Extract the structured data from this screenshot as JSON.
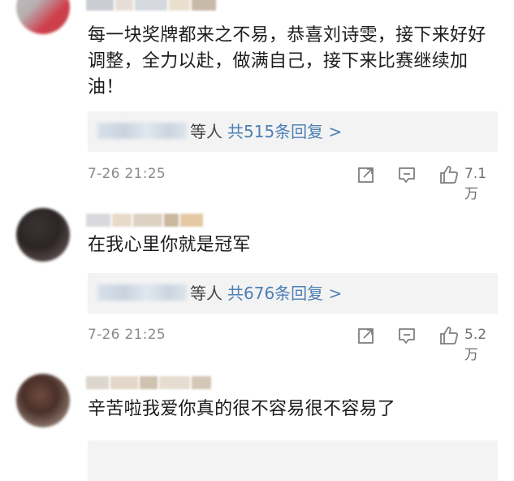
{
  "comments": [
    {
      "text": "每一块奖牌都来之不易，恭喜刘诗雯，接下来好好调整，全力以赴，做满自己，接下来比赛继续加油！",
      "reply_prefix": "等人",
      "reply_link": "共515条回复 >",
      "time": "7-26 21:25",
      "likes": "7.1万"
    },
    {
      "text": "在我心里你就是冠军",
      "reply_prefix": "等人",
      "reply_link": "共676条回复 >",
      "time": "7-26 21:25",
      "likes": "5.2万"
    },
    {
      "text": "辛苦啦我爱你真的很不容易很不容易了"
    }
  ],
  "icons": [
    "share-icon",
    "reply-icon",
    "like-icon"
  ],
  "colors": {
    "link": "#4d7fb6",
    "reply_box_bg": "#f3f3f3",
    "meta_text": "#8a8a8a"
  }
}
